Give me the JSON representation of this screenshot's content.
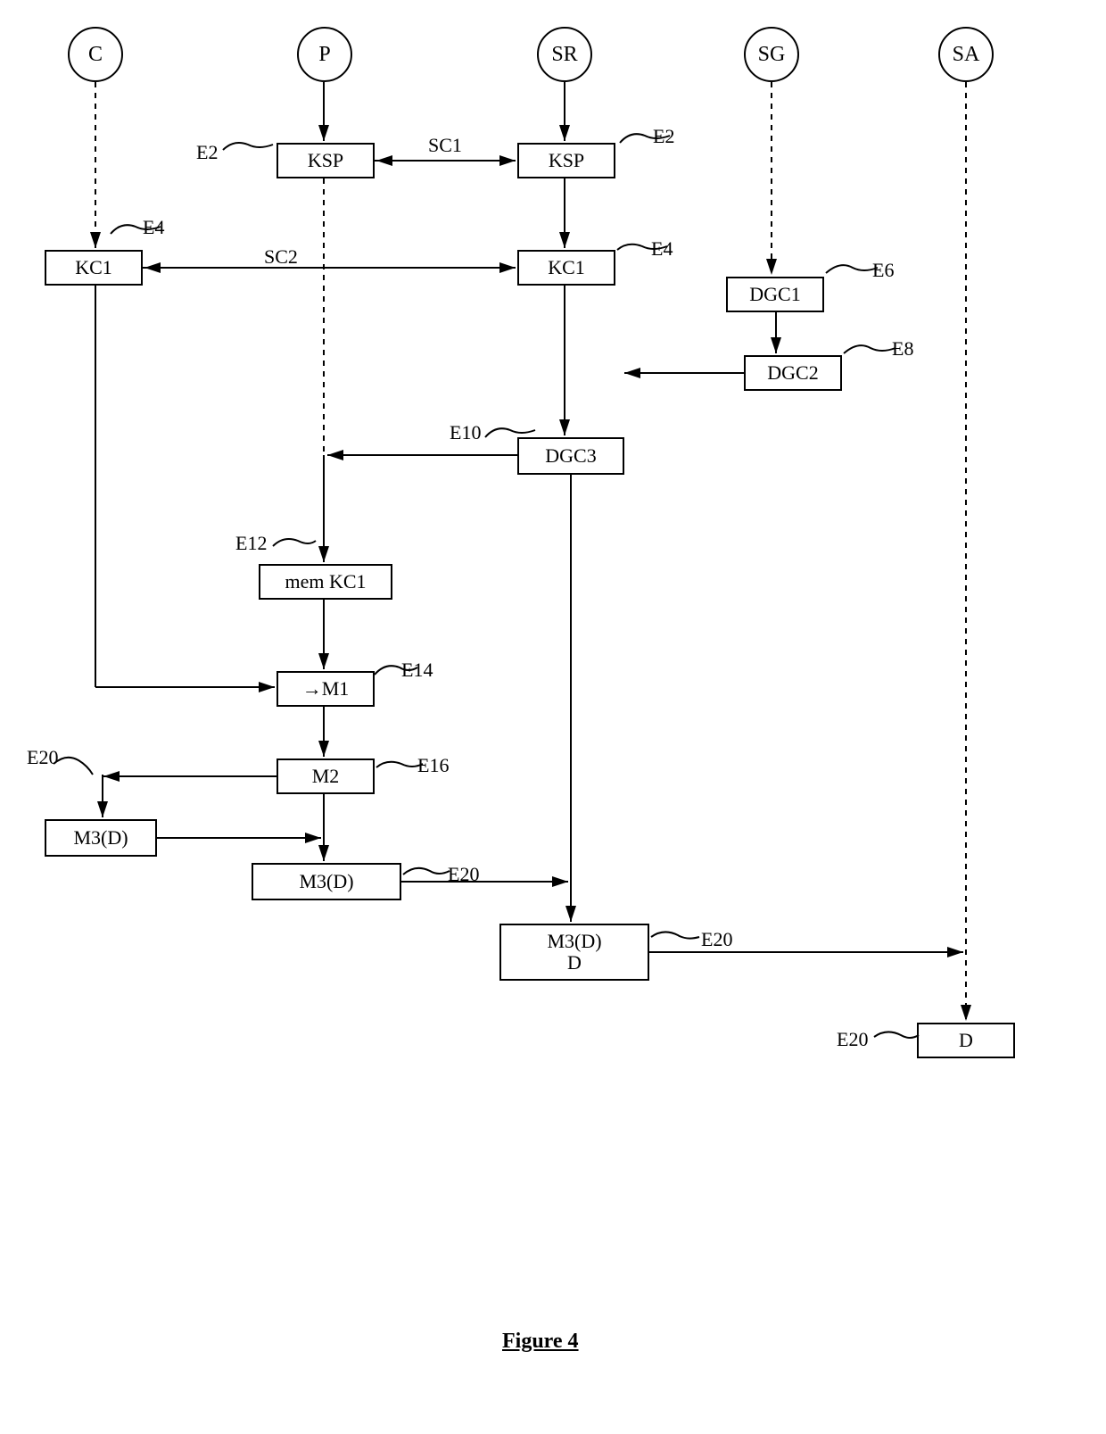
{
  "circles": {
    "C": "C",
    "P": "P",
    "SR": "SR",
    "SG": "SG",
    "SA": "SA"
  },
  "boxes": {
    "ksp_p": "KSP",
    "ksp_sr": "KSP",
    "kc1_c": "KC1",
    "kc1_sr": "KC1",
    "dgc1": "DGC1",
    "dgc2": "DGC2",
    "dgc3": "DGC3",
    "memkc1": "mem KC1",
    "m1": "→M1",
    "m2": "M2",
    "m3d_c": "M3(D)",
    "m3d_p": "M3(D)",
    "m3d_d": "M3(D)\nD",
    "d": "D"
  },
  "labels": {
    "e2_l": "E2",
    "e2_r": "E2",
    "e4_l": "E4",
    "e4_r": "E4",
    "e6": "E6",
    "e8": "E8",
    "e10": "E10",
    "e12": "E12",
    "e14": "E14",
    "e16": "E16",
    "e20_l": "E20",
    "e20_m": "E20",
    "e20_r": "E20",
    "e20_b": "E20",
    "sc1": "SC1",
    "sc2": "SC2"
  },
  "caption": "Figure 4"
}
